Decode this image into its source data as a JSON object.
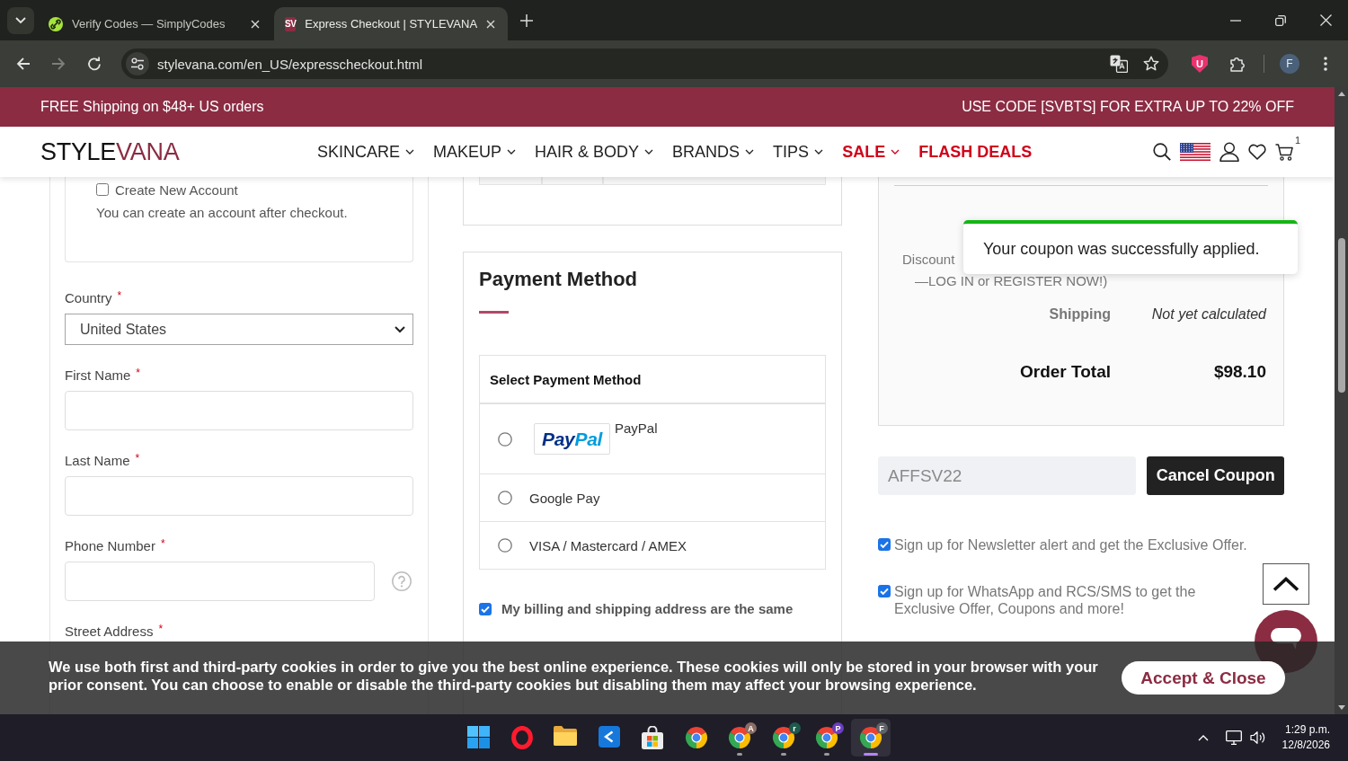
{
  "browser": {
    "tabs": [
      {
        "kind": "site",
        "title": "Verify Codes — SimplyCodes",
        "selected": false
      },
      {
        "kind": "lettered",
        "icon_text": "SV",
        "title": "Express Checkout | STYLEVANA",
        "selected": true
      }
    ],
    "forward_disabled": true,
    "url": "stylevana.com/en_US/expresscheckout.html",
    "extension_letter": "U",
    "profile_letter": "F"
  },
  "promo_bar": {
    "left": "FREE Shipping on $48+ US orders",
    "right": "USE CODE [SVBTS] FOR EXTRA UP TO 22% OFF"
  },
  "header": {
    "logo": {
      "text": "STYLE",
      "accent_text": "VANA"
    },
    "menu": [
      {
        "label": "SKINCARE",
        "has_submenu": true,
        "highlighted": false
      },
      {
        "label": "MAKEUP",
        "has_submenu": true,
        "highlighted": false
      },
      {
        "label": "HAIR & BODY",
        "has_submenu": true,
        "highlighted": false
      },
      {
        "label": "BRANDS",
        "has_submenu": true,
        "highlighted": false
      },
      {
        "label": "TIPS",
        "has_submenu": true,
        "highlighted": false
      },
      {
        "label": "SALE",
        "has_submenu": true,
        "highlighted": true
      },
      {
        "label": "FLASH DEALS",
        "has_submenu": false,
        "highlighted": true
      }
    ],
    "cart_count": "1"
  },
  "account": {
    "option": "Create New Account",
    "checked": false,
    "note": "You can create an account after checkout."
  },
  "address_form": {
    "fields": [
      {
        "kind": "select",
        "label": "Country",
        "marker": "*",
        "value": "United States"
      },
      {
        "kind": "text",
        "label": "First Name",
        "marker": "*"
      },
      {
        "kind": "text",
        "label": "Last Name",
        "marker": "*"
      },
      {
        "kind": "phone",
        "label": "Phone Number",
        "marker": "*"
      },
      {
        "label": "Street Address",
        "marker": "*"
      }
    ]
  },
  "payment": {
    "title": "Payment Method",
    "table_heading": "Select Payment Method",
    "options": [
      {
        "kind": "logo",
        "logo": {
          "text": "Pay",
          "accent_text": "Pal"
        },
        "label": "PayPal",
        "selected": false
      },
      {
        "kind": "plain",
        "label": "Google Pay",
        "selected": false
      },
      {
        "kind": "plain",
        "label": "VISA / Mastercard / AMEX",
        "selected": false
      }
    ],
    "same_address": {
      "label": "My billing and shipping address are the same",
      "checked": true
    }
  },
  "summary": {
    "discount_label": "Discount",
    "discount_note": "—LOG IN or REGISTER NOW!)",
    "rows": [
      {
        "kind": "shipping",
        "label": "Shipping",
        "value": "Not yet calculated"
      },
      {
        "kind": "total",
        "label": "Order Total",
        "value": "$98.10"
      }
    ]
  },
  "toast": {
    "message": "Your coupon was successfully applied."
  },
  "coupon": {
    "value": "AFFSV22",
    "disabled": true,
    "button": "Cancel Coupon"
  },
  "subscriptions": [
    {
      "label": "Sign up for Newsletter alert and get the Exclusive Offer.",
      "checked": true
    },
    {
      "label": "Sign up for WhatsApp and RCS/SMS to get the Exclusive Offer, Coupons and more!",
      "checked": true
    }
  ],
  "cookie_banner": {
    "message": "We use both first and third-party cookies in order to give you the best online experience. These cookies will only be stored in your browser with your prior consent. You can choose to enable or disable the third-party cookies but disabling them may affect your browsing experience.",
    "button": "Accept & Close"
  },
  "taskbar": {
    "apps": [
      {
        "kind": "start",
        "running": false,
        "selected": false
      },
      {
        "kind": "ring",
        "running": false,
        "selected": false
      },
      {
        "kind": "folder",
        "running": false,
        "selected": false
      },
      {
        "kind": "tile",
        "running": false,
        "selected": false
      },
      {
        "kind": "bag",
        "running": false,
        "selected": false
      },
      {
        "kind": "browser",
        "running": false,
        "selected": false
      },
      {
        "kind": "browser",
        "badge": {
          "text": "A",
          "color": "#8c6d64"
        },
        "running": true,
        "selected": false
      },
      {
        "kind": "browser",
        "badge": {
          "text": "r",
          "color": "#1d5a4c"
        },
        "running": true,
        "selected": false
      },
      {
        "kind": "browser",
        "badge": {
          "text": "P",
          "color": "#6a3fc0"
        },
        "running": true,
        "selected": false
      },
      {
        "kind": "browser",
        "badge": {
          "text": "F",
          "color": "#5f6368"
        },
        "running": true,
        "selected": true
      }
    ],
    "time": "1:29 p.m.",
    "date": "12/8/2026"
  }
}
